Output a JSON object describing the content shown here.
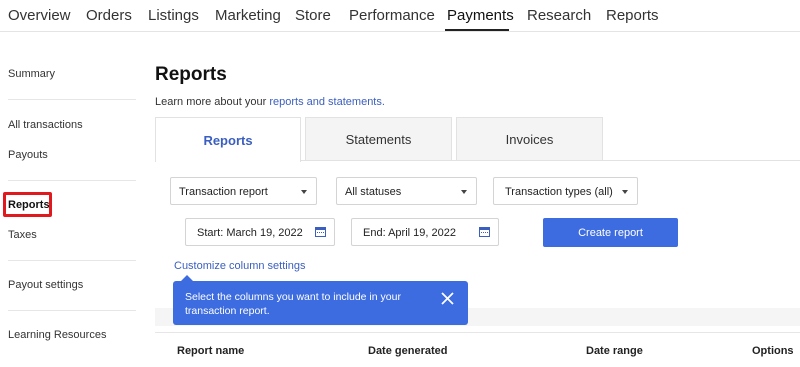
{
  "topnav": {
    "tabs": [
      {
        "label": "Overview"
      },
      {
        "label": "Orders"
      },
      {
        "label": "Listings"
      },
      {
        "label": "Marketing"
      },
      {
        "label": "Store"
      },
      {
        "label": "Performance"
      },
      {
        "label": "Payments"
      },
      {
        "label": "Research"
      },
      {
        "label": "Reports"
      }
    ],
    "active": "Payments"
  },
  "sidebar": {
    "items": [
      {
        "label": "Summary"
      },
      {
        "label": "All transactions"
      },
      {
        "label": "Payouts"
      },
      {
        "label": "Reports"
      },
      {
        "label": "Taxes"
      },
      {
        "label": "Payout settings"
      },
      {
        "label": "Learning Resources"
      }
    ],
    "active": "Reports",
    "highlight_color": "#e0191f"
  },
  "main": {
    "title": "Reports",
    "learn_prefix": "Learn more about your ",
    "learn_link": "reports and statements.",
    "tabs": [
      {
        "label": "Reports"
      },
      {
        "label": "Statements"
      },
      {
        "label": "Invoices"
      }
    ],
    "active_tab": "Reports",
    "filters": {
      "report_type": "Transaction report",
      "status": "All statuses",
      "transaction_types": "Transaction types (all)"
    },
    "start_date": "Start: March 19, 2022",
    "end_date": "End: April 19, 2022",
    "create_button": "Create report",
    "customize_link": "Customize column settings",
    "tooltip": "Select the columns you want to include in your transaction report.",
    "table": {
      "columns": [
        "Report name",
        "Date generated",
        "Date range",
        "Options"
      ]
    }
  },
  "colors": {
    "accent": "#3d6ce0",
    "link": "#3b5fc0"
  }
}
